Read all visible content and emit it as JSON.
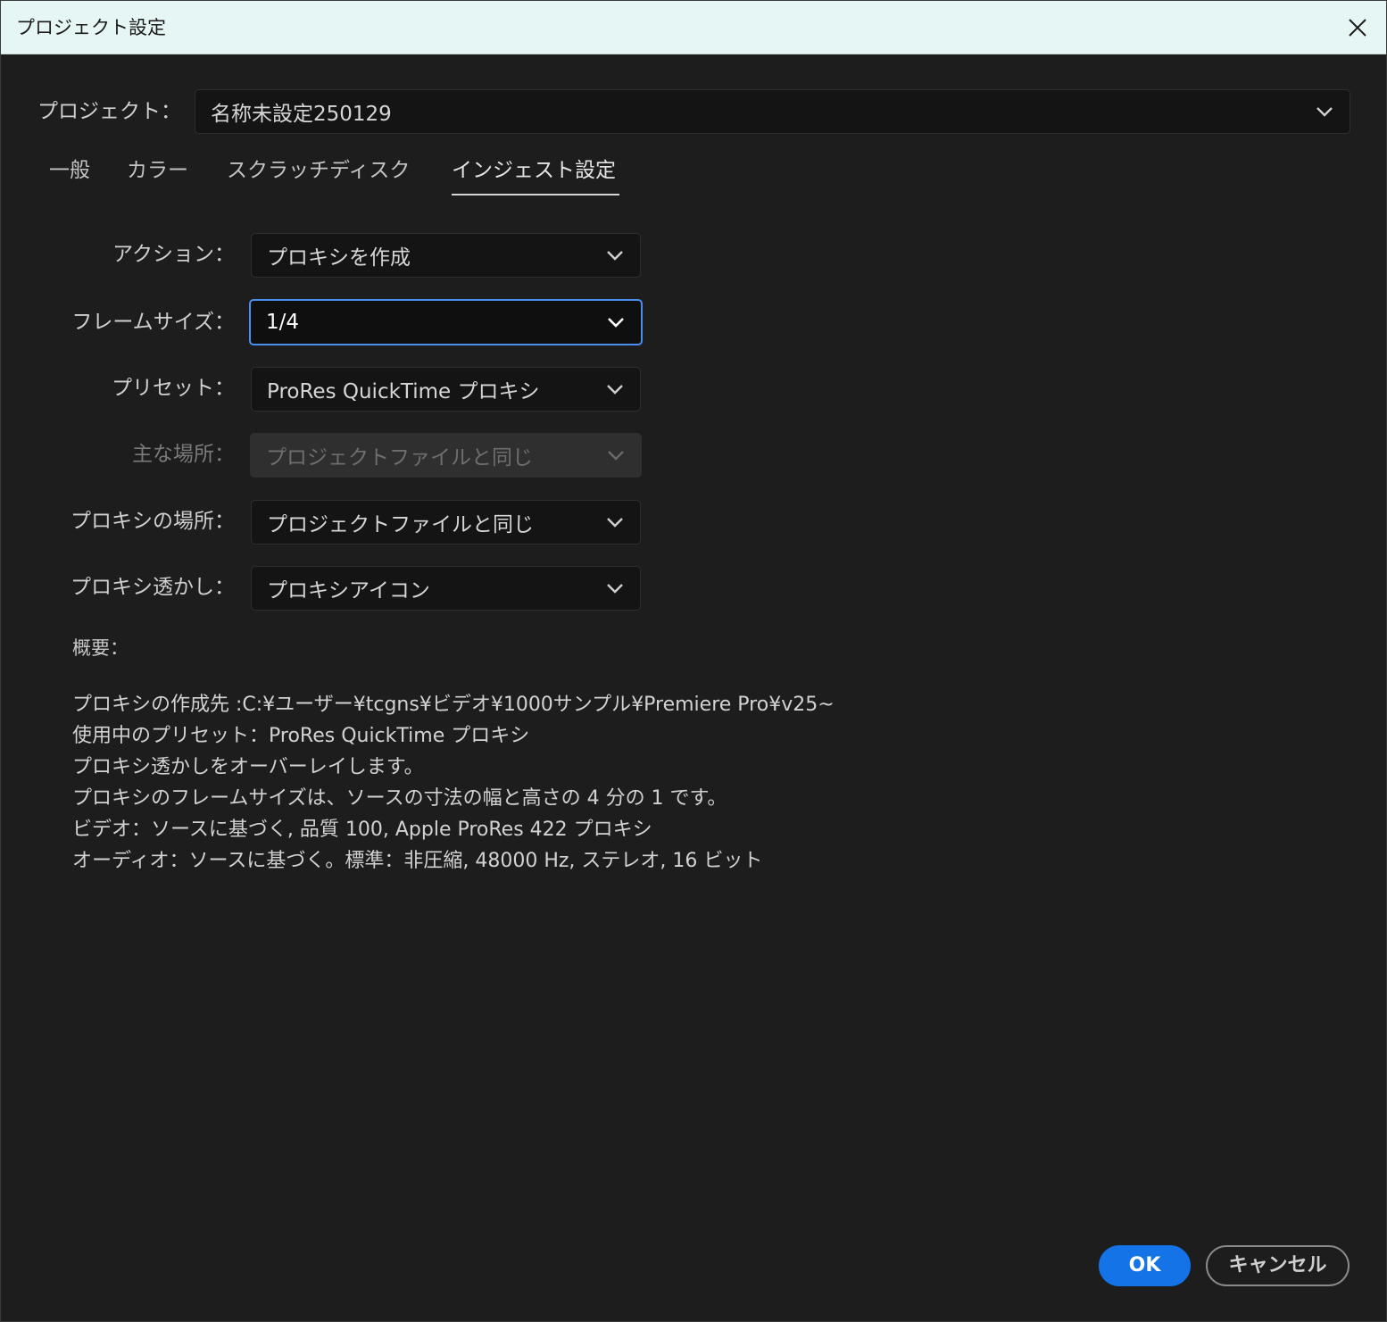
{
  "window": {
    "title": "プロジェクト設定"
  },
  "project": {
    "label": "プロジェクト：",
    "value": "名称未設定250129"
  },
  "tabs": [
    {
      "label": "一般",
      "active": false
    },
    {
      "label": "カラー",
      "active": false
    },
    {
      "label": "スクラッチディスク",
      "active": false
    },
    {
      "label": "インジェスト設定",
      "active": true
    }
  ],
  "fields": {
    "action": {
      "label": "アクション：",
      "value": "プロキシを作成"
    },
    "frame_size": {
      "label": "フレームサイズ：",
      "value": "1/4"
    },
    "preset": {
      "label": "プリセット：",
      "value": "ProRes QuickTime プロキシ"
    },
    "primary_location": {
      "label": "主な場所：",
      "value": "プロジェクトファイルと同じ",
      "disabled": true
    },
    "proxy_location": {
      "label": "プロキシの場所：",
      "value": "プロジェクトファイルと同じ"
    },
    "proxy_watermark": {
      "label": "プロキシ透かし：",
      "value": "プロキシアイコン"
    }
  },
  "summary": {
    "title": "概要：",
    "lines": [
      "プロキシの作成先 :C:¥ユーザー¥tcgns¥ビデオ¥1000サンプル¥Premiere Pro¥v25~",
      "使用中のプリセット：ProRes QuickTime プロキシ",
      "プロキシ透かしをオーバーレイします。",
      "プロキシのフレームサイズは、ソースの寸法の幅と高さの 4 分の 1 です。",
      "ビデオ：ソースに基づく, 品質 100, Apple ProRes 422 プロキシ",
      "オーディオ：ソースに基づく。標準：非圧縮, 48000 Hz, ステレオ, 16 ビット"
    ]
  },
  "buttons": {
    "ok": "OK",
    "cancel": "キャンセル"
  },
  "colors": {
    "accent": "#1473e6",
    "focus_ring": "#4a8ef0",
    "background": "#1d1d1d",
    "titlebar": "#e6f6f4"
  },
  "icons": {
    "close": "close-icon",
    "dropdown": "chevron-down-icon"
  }
}
